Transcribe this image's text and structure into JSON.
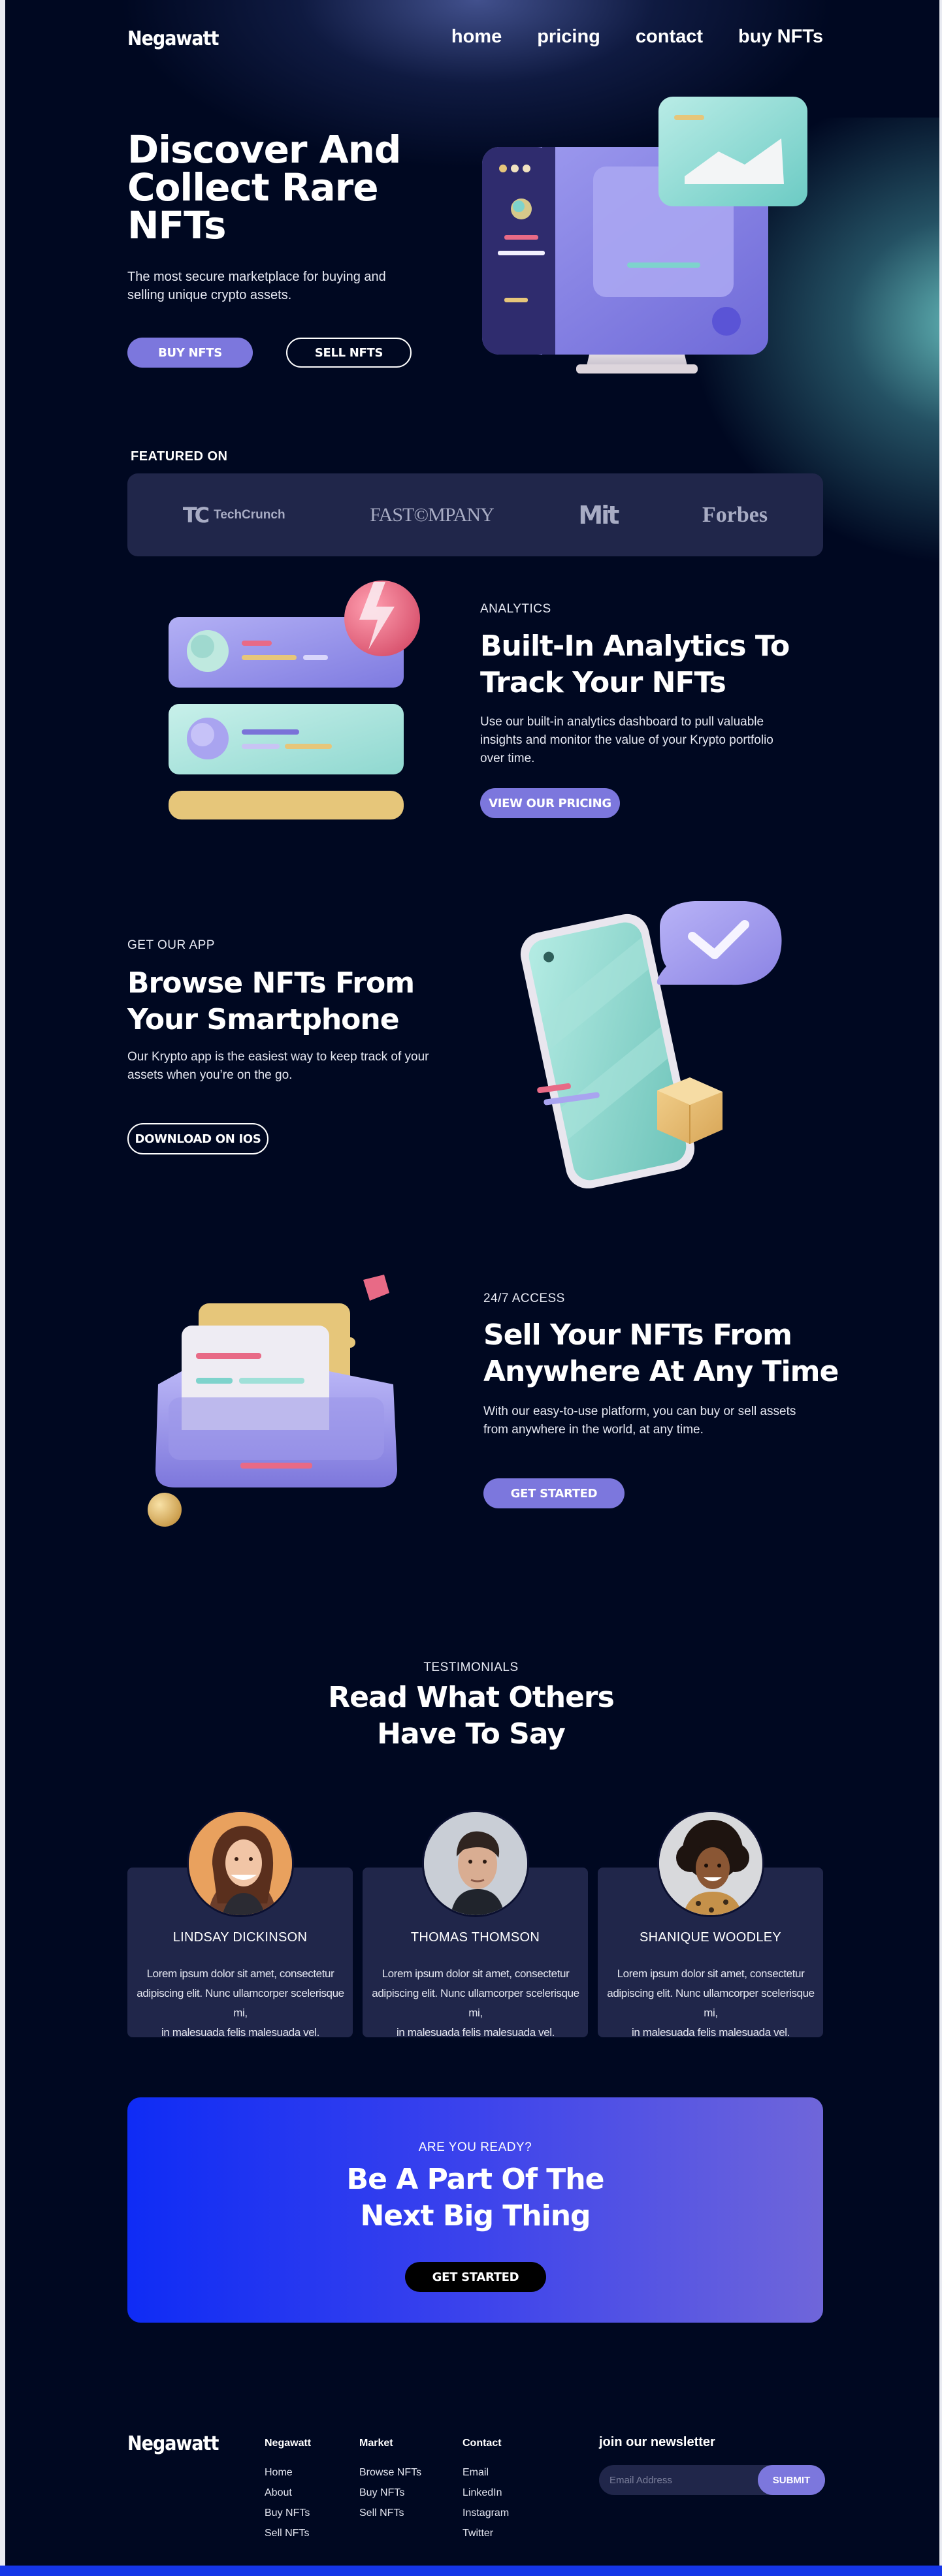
{
  "brand": {
    "logo": "Negawatt"
  },
  "nav": {
    "items": [
      "home",
      "pricing",
      "contact",
      "buy NFTs"
    ]
  },
  "hero": {
    "title_lines": [
      "Discover And",
      "Collect Rare",
      "NFTs"
    ],
    "subtitle": "The most secure marketplace for buying and selling unique crypto assets.",
    "buy_label": "BUY NFTS",
    "sell_label": "SELL NFTS"
  },
  "featured": {
    "label": "FEATURED ON",
    "logos": [
      "TechCrunch",
      "FAST COMPANY",
      "MIT",
      "Forbes"
    ],
    "techcrunch_mark": "TC",
    "fastcompany_text": "FAST©MPANY",
    "mit_text": "Mit"
  },
  "analytics": {
    "eyebrow": "ANALYTICS",
    "title_lines": [
      "Built-In Analytics To",
      "Track Your NFTs"
    ],
    "text": "Use our built-in analytics dashboard to pull valuable insights and monitor the value of your Krypto portfolio over time.",
    "button": "VIEW OUR PRICING"
  },
  "app": {
    "eyebrow": "GET OUR APP",
    "title_lines": [
      "Browse NFTs From",
      "Your Smartphone"
    ],
    "text": "Our Krypto app is the easiest way to keep track of your assets when you’re on the go.",
    "button": "DOWNLOAD ON IOS"
  },
  "access": {
    "eyebrow": "24/7 ACCESS",
    "title_lines": [
      "Sell Your NFTs From",
      "Anywhere At Any Time"
    ],
    "text": "With our easy-to-use platform, you can buy or sell assets from anywhere in the world, at any time.",
    "button": "GET STARTED"
  },
  "testimonials": {
    "eyebrow": "TESTIMONIALS",
    "title_lines": [
      "Read What Others",
      "Have To Say"
    ],
    "items": [
      {
        "name": "LINDSAY DICKINSON",
        "quote_lines": [
          "Lorem ipsum dolor sit amet, consectetur",
          "adipiscing elit. Nunc ullamcorper scelerisque mi,",
          "in malesuada felis malesuada vel."
        ]
      },
      {
        "name": "THOMAS THOMSON",
        "quote_lines": [
          "Lorem ipsum dolor sit amet, consectetur",
          "adipiscing elit. Nunc ullamcorper scelerisque mi,",
          "in malesuada felis malesuada vel."
        ]
      },
      {
        "name": "SHANIQUE WOODLEY",
        "quote_lines": [
          "Lorem ipsum dolor sit amet, consectetur",
          "adipiscing elit. Nunc ullamcorper scelerisque mi,",
          "in malesuada felis malesuada vel."
        ]
      }
    ]
  },
  "cta": {
    "eyebrow": "ARE YOU READY?",
    "title_lines": [
      "Be A Part Of The",
      "Next Big Thing"
    ],
    "button": "GET STARTED"
  },
  "footer": {
    "logo": "Negawatt",
    "columns": [
      {
        "head": "Negawatt",
        "items": [
          "Home",
          "About",
          "Buy NFTs",
          "Sell NFTs"
        ]
      },
      {
        "head": "Market",
        "items": [
          "Browse NFTs",
          "Buy NFTs",
          "Sell NFTs"
        ]
      },
      {
        "head": "Contact",
        "items": [
          "Email",
          "LinkedIn",
          "Instagram",
          "Twitter"
        ]
      }
    ],
    "newsletter": {
      "head": "join our newsletter",
      "placeholder": "Email Address",
      "button": "SUBMIT"
    }
  },
  "colors": {
    "background": "#000821",
    "accent": "#7c77dd",
    "card": "#20264a",
    "cta_gradient_start": "#0f2cf5",
    "cta_gradient_end": "#6f66da",
    "teal": "#7ed3cc",
    "yellow": "#e6c67a",
    "pink": "#e86a86"
  }
}
